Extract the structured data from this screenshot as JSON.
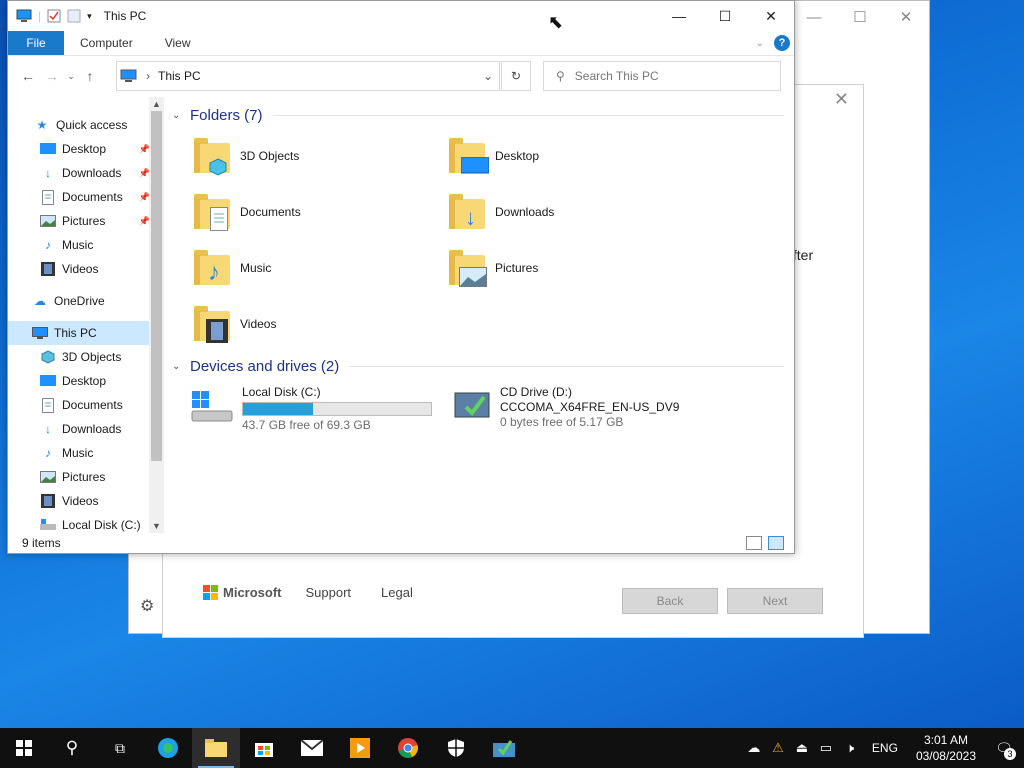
{
  "background_window": {
    "minimize": "—",
    "maximize": "☐",
    "close": "✕"
  },
  "dialog": {
    "close": "✕",
    "partial_text": "ıfter",
    "footer": {
      "brand": "Microsoft",
      "support": "Support",
      "legal": "Legal"
    },
    "back_label": "Back",
    "next_label": "Next"
  },
  "explorer": {
    "title": "This PC",
    "controls": {
      "minimize": "—",
      "maximize": "☐",
      "close": "✕"
    },
    "ribbon": {
      "file": "File",
      "tabs": [
        "Computer",
        "View"
      ]
    },
    "address": "This PC",
    "search_placeholder": "Search This PC",
    "nav": {
      "quick_access": "Quick access",
      "quick_items": [
        "Desktop",
        "Downloads",
        "Documents",
        "Pictures",
        "Music",
        "Videos"
      ],
      "onedrive": "OneDrive",
      "this_pc": "This PC",
      "pc_items": [
        "3D Objects",
        "Desktop",
        "Documents",
        "Downloads",
        "Music",
        "Pictures",
        "Videos",
        "Local Disk (C:)"
      ]
    },
    "folders_header": "Folders (7)",
    "folders": [
      "3D Objects",
      "Desktop",
      "Documents",
      "Downloads",
      "Music",
      "Pictures",
      "Videos"
    ],
    "devices_header": "Devices and drives (2)",
    "drives": [
      {
        "name": "Local Disk (C:)",
        "free": "43.7 GB free of 69.3 GB",
        "used_fraction": 0.37
      },
      {
        "name": "CD Drive (D:)",
        "label": "CCCOMA_X64FRE_EN-US_DV9",
        "free": "0 bytes free of 5.17 GB"
      }
    ],
    "status": "9 items"
  },
  "taskbar": {
    "language": "ENG",
    "time": "3:01 AM",
    "date": "03/08/2023",
    "notifications": "3"
  }
}
